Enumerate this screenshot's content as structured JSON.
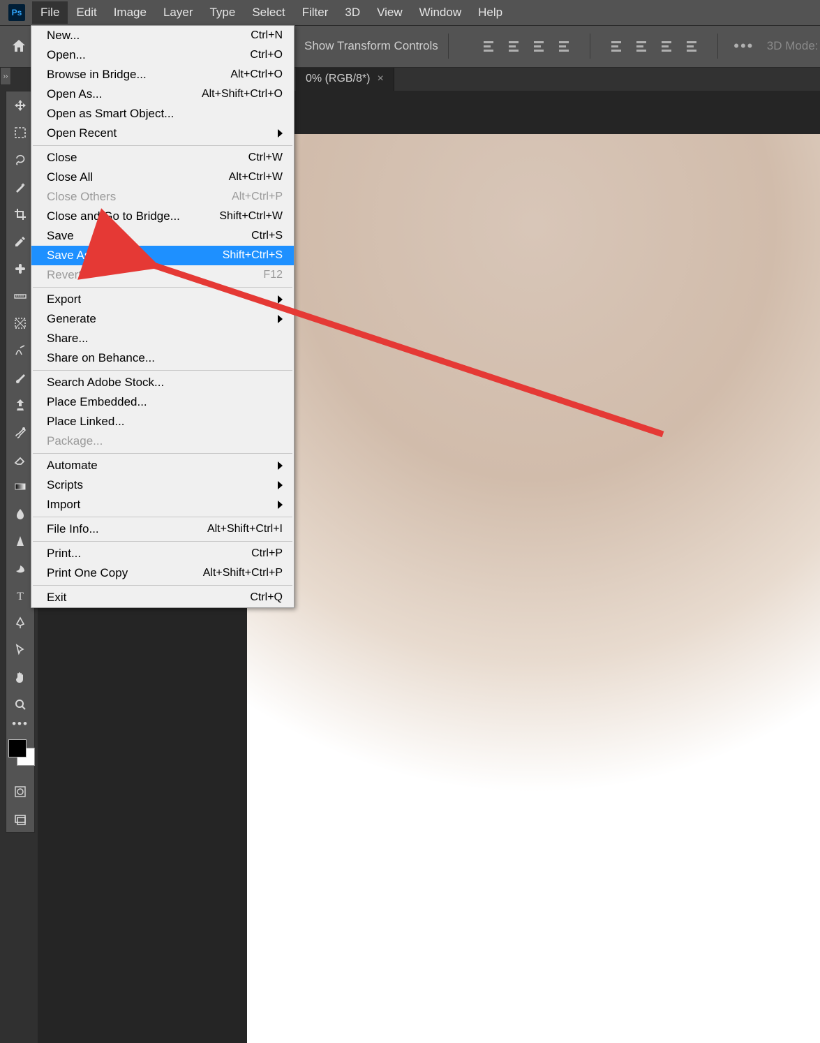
{
  "app": {
    "logo_text": "Ps"
  },
  "menubar": {
    "items": [
      "File",
      "Edit",
      "Image",
      "Layer",
      "Type",
      "Select",
      "Filter",
      "3D",
      "View",
      "Window",
      "Help"
    ],
    "active_index": 0
  },
  "optionsbar": {
    "show_transform_label": "Show Transform Controls",
    "mode3d_label": "3D Mode:"
  },
  "tab": {
    "title": "0% (RGB/8*)",
    "close": "×"
  },
  "dropdown": {
    "groups": [
      [
        {
          "label": "New...",
          "shortcut": "Ctrl+N"
        },
        {
          "label": "Open...",
          "shortcut": "Ctrl+O"
        },
        {
          "label": "Browse in Bridge...",
          "shortcut": "Alt+Ctrl+O"
        },
        {
          "label": "Open As...",
          "shortcut": "Alt+Shift+Ctrl+O"
        },
        {
          "label": "Open as Smart Object..."
        },
        {
          "label": "Open Recent",
          "submenu": true
        }
      ],
      [
        {
          "label": "Close",
          "shortcut": "Ctrl+W"
        },
        {
          "label": "Close All",
          "shortcut": "Alt+Ctrl+W"
        },
        {
          "label": "Close Others",
          "shortcut": "Alt+Ctrl+P",
          "disabled": true
        },
        {
          "label": "Close and Go to Bridge...",
          "shortcut": "Shift+Ctrl+W"
        },
        {
          "label": "Save",
          "shortcut": "Ctrl+S"
        },
        {
          "label": "Save As...",
          "shortcut": "Shift+Ctrl+S",
          "highlight": true
        },
        {
          "label": "Revert",
          "shortcut": "F12",
          "disabled": true
        }
      ],
      [
        {
          "label": "Export",
          "submenu": true
        },
        {
          "label": "Generate",
          "submenu": true
        },
        {
          "label": "Share..."
        },
        {
          "label": "Share on Behance..."
        }
      ],
      [
        {
          "label": "Search Adobe Stock..."
        },
        {
          "label": "Place Embedded..."
        },
        {
          "label": "Place Linked..."
        },
        {
          "label": "Package...",
          "disabled": true
        }
      ],
      [
        {
          "label": "Automate",
          "submenu": true
        },
        {
          "label": "Scripts",
          "submenu": true
        },
        {
          "label": "Import",
          "submenu": true
        }
      ],
      [
        {
          "label": "File Info...",
          "shortcut": "Alt+Shift+Ctrl+I"
        }
      ],
      [
        {
          "label": "Print...",
          "shortcut": "Ctrl+P"
        },
        {
          "label": "Print One Copy",
          "shortcut": "Alt+Shift+Ctrl+P"
        }
      ],
      [
        {
          "label": "Exit",
          "shortcut": "Ctrl+Q"
        }
      ]
    ]
  },
  "tools": [
    "move-tool",
    "marquee-tool",
    "lasso-tool",
    "magic-wand-tool",
    "crop-tool",
    "eyedropper-tool",
    "healing-tool",
    "ruler-tool",
    "frame-tool",
    "wrinkle-tool",
    "brush-tool",
    "clone-stamp-tool",
    "history-brush-tool",
    "eraser-tool",
    "gradient-tool",
    "blur-tool",
    "sharpen-tool",
    "dodge-tool",
    "type-tool",
    "pen-tool",
    "path-select-tool",
    "hand-tool",
    "zoom-tool"
  ],
  "extra_tools": [
    "quickmask-tool",
    "screenmode-tool"
  ],
  "options_icons": [
    "align-left-icon",
    "align-center-h-icon",
    "align-right-icon",
    "align-fill-icon",
    "align-top-icon",
    "align-center-v-icon",
    "align-bottom-icon",
    "distribute-icon",
    "more-options-icon"
  ]
}
